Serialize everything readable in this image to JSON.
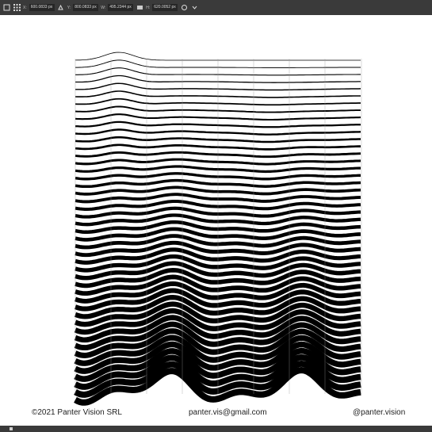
{
  "toolbar": {
    "x_value": "600.0833 px",
    "y_value": "800.0833 px",
    "w_value": "495.2344 px",
    "h_value": "620.0052 px",
    "x_label": "X:",
    "y_label": "Y:",
    "w_label": "W:",
    "h_label": "H:"
  },
  "footer": {
    "copyright": "©2021 Panter Vision SRL",
    "email": "panter.vis@gmail.com",
    "handle": "@panter.vision"
  },
  "art": {
    "line_color": "#000000",
    "background": "#ffffff",
    "line_count": 46
  }
}
